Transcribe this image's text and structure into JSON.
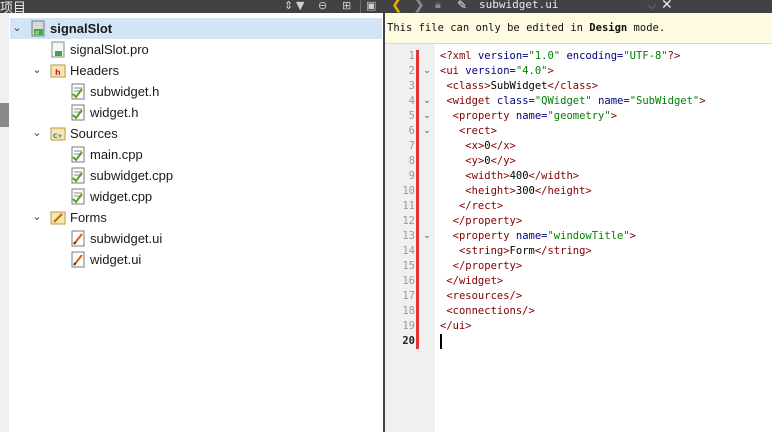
{
  "project_panel": {
    "title": "项目",
    "toolbar_icons": [
      "chevron-updown-icon",
      "filter-icon",
      "link-icon",
      "split-icon",
      "close-panel-icon"
    ]
  },
  "tree": [
    {
      "label": "signalSlot",
      "level": 0,
      "arrow": "down",
      "icon": "qt-project-icon",
      "bold": true,
      "selected": true
    },
    {
      "label": "signalSlot.pro",
      "level": 1,
      "arrow": "",
      "icon": "pro-file-icon"
    },
    {
      "label": "Headers",
      "level": 1,
      "arrow": "down",
      "icon": "headers-folder-icon"
    },
    {
      "label": "subwidget.h",
      "level": 2,
      "arrow": "",
      "icon": "header-file-icon"
    },
    {
      "label": "widget.h",
      "level": 2,
      "arrow": "",
      "icon": "header-file-icon"
    },
    {
      "label": "Sources",
      "level": 1,
      "arrow": "down",
      "icon": "sources-folder-icon"
    },
    {
      "label": "main.cpp",
      "level": 2,
      "arrow": "",
      "icon": "cpp-file-icon"
    },
    {
      "label": "subwidget.cpp",
      "level": 2,
      "arrow": "",
      "icon": "cpp-file-icon"
    },
    {
      "label": "widget.cpp",
      "level": 2,
      "arrow": "",
      "icon": "cpp-file-icon"
    },
    {
      "label": "Forms",
      "level": 1,
      "arrow": "down",
      "icon": "forms-folder-icon"
    },
    {
      "label": "subwidget.ui",
      "level": 2,
      "arrow": "",
      "icon": "ui-file-icon"
    },
    {
      "label": "widget.ui",
      "level": 2,
      "arrow": "",
      "icon": "ui-file-icon"
    }
  ],
  "editor": {
    "tab_title": "subwidget.ui",
    "notice": {
      "before": "This file can only be edited in ",
      "emph": "Design",
      "after": " mode."
    },
    "current_line": 20,
    "lines": [
      {
        "n": 1,
        "fold": "",
        "indent": "",
        "tokens": [
          [
            "tag",
            "<?xml "
          ],
          [
            "attr",
            "version="
          ],
          [
            "val",
            "\"1.0\""
          ],
          [
            "txt",
            " "
          ],
          [
            "attr",
            "encoding="
          ],
          [
            "val",
            "\"UTF-8\""
          ],
          [
            "tag",
            "?>"
          ]
        ]
      },
      {
        "n": 2,
        "fold": "v",
        "indent": "",
        "tokens": [
          [
            "tag",
            "<ui "
          ],
          [
            "attr",
            "version="
          ],
          [
            "val",
            "\"4.0\""
          ],
          [
            "tag",
            ">"
          ]
        ]
      },
      {
        "n": 3,
        "fold": "",
        "indent": " ",
        "tokens": [
          [
            "tag",
            "<class>"
          ],
          [
            "txt",
            "SubWidget"
          ],
          [
            "tag",
            "</class>"
          ]
        ]
      },
      {
        "n": 4,
        "fold": "v",
        "indent": " ",
        "tokens": [
          [
            "tag",
            "<widget "
          ],
          [
            "attr",
            "class="
          ],
          [
            "val",
            "\"QWidget\""
          ],
          [
            "txt",
            " "
          ],
          [
            "attr",
            "name="
          ],
          [
            "val",
            "\"SubWidget\""
          ],
          [
            "tag",
            ">"
          ]
        ]
      },
      {
        "n": 5,
        "fold": "v",
        "indent": "  ",
        "tokens": [
          [
            "tag",
            "<property "
          ],
          [
            "attr",
            "name="
          ],
          [
            "val",
            "\"geometry\""
          ],
          [
            "tag",
            ">"
          ]
        ]
      },
      {
        "n": 6,
        "fold": "v",
        "indent": "   ",
        "tokens": [
          [
            "tag",
            "<rect>"
          ]
        ]
      },
      {
        "n": 7,
        "fold": "",
        "indent": "    ",
        "tokens": [
          [
            "tag",
            "<x>"
          ],
          [
            "txt",
            "0"
          ],
          [
            "tag",
            "</x>"
          ]
        ]
      },
      {
        "n": 8,
        "fold": "",
        "indent": "    ",
        "tokens": [
          [
            "tag",
            "<y>"
          ],
          [
            "txt",
            "0"
          ],
          [
            "tag",
            "</y>"
          ]
        ]
      },
      {
        "n": 9,
        "fold": "",
        "indent": "    ",
        "tokens": [
          [
            "tag",
            "<width>"
          ],
          [
            "txt",
            "400"
          ],
          [
            "tag",
            "</width>"
          ]
        ]
      },
      {
        "n": 10,
        "fold": "",
        "indent": "    ",
        "tokens": [
          [
            "tag",
            "<height>"
          ],
          [
            "txt",
            "300"
          ],
          [
            "tag",
            "</height>"
          ]
        ]
      },
      {
        "n": 11,
        "fold": "",
        "indent": "   ",
        "tokens": [
          [
            "tag",
            "</rect>"
          ]
        ]
      },
      {
        "n": 12,
        "fold": "",
        "indent": "  ",
        "tokens": [
          [
            "tag",
            "</property>"
          ]
        ]
      },
      {
        "n": 13,
        "fold": "v",
        "indent": "  ",
        "tokens": [
          [
            "tag",
            "<property "
          ],
          [
            "attr",
            "name="
          ],
          [
            "val",
            "\"windowTitle\""
          ],
          [
            "tag",
            ">"
          ]
        ]
      },
      {
        "n": 14,
        "fold": "",
        "indent": "   ",
        "tokens": [
          [
            "tag",
            "<string>"
          ],
          [
            "txt",
            "Form"
          ],
          [
            "tag",
            "</string>"
          ]
        ]
      },
      {
        "n": 15,
        "fold": "",
        "indent": "  ",
        "tokens": [
          [
            "tag",
            "</property>"
          ]
        ]
      },
      {
        "n": 16,
        "fold": "",
        "indent": " ",
        "tokens": [
          [
            "tag",
            "</widget>"
          ]
        ]
      },
      {
        "n": 17,
        "fold": "",
        "indent": " ",
        "tokens": [
          [
            "tag",
            "<resources/>"
          ]
        ]
      },
      {
        "n": 18,
        "fold": "",
        "indent": " ",
        "tokens": [
          [
            "tag",
            "<connections/>"
          ]
        ]
      },
      {
        "n": 19,
        "fold": "",
        "indent": "",
        "tokens": [
          [
            "tag",
            "</ui>"
          ]
        ]
      },
      {
        "n": 20,
        "fold": "",
        "indent": "",
        "tokens": []
      }
    ]
  },
  "colors": {
    "tag": "#800000",
    "attr": "#000080",
    "value": "#008000",
    "modified_marker": "#e63232",
    "selection": "#d3e4f5",
    "dark_bar": "#404244"
  }
}
